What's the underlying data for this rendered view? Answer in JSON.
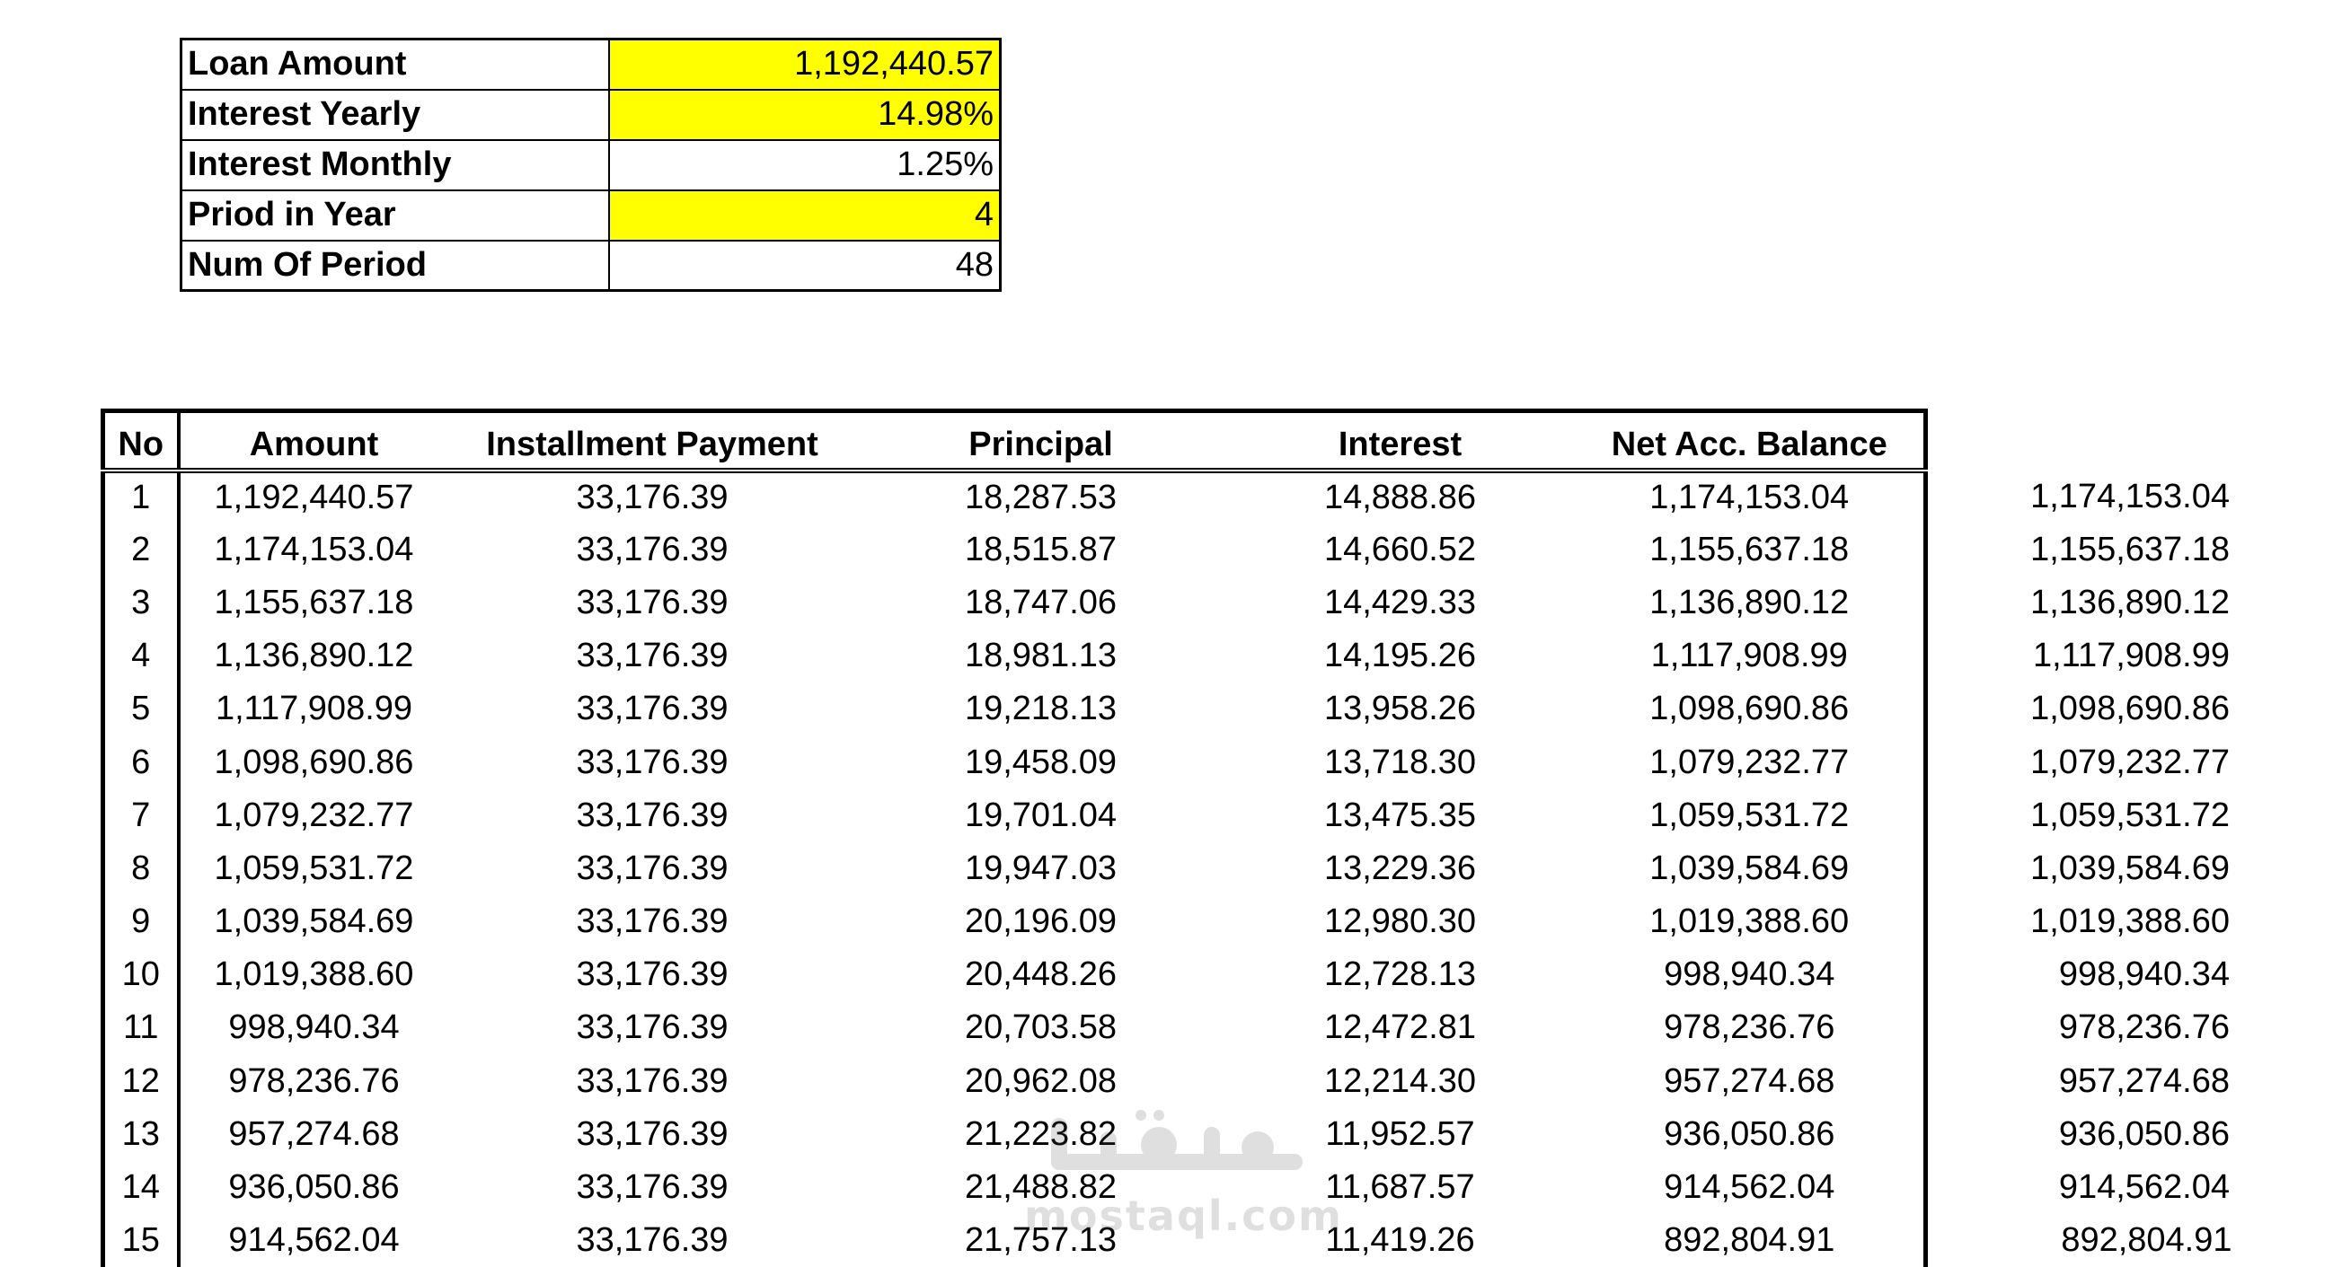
{
  "summary": [
    {
      "label": "Loan Amount",
      "value": "1,192,440.57",
      "highlight": true
    },
    {
      "label": "Interest Yearly",
      "value": "14.98%",
      "highlight": true
    },
    {
      "label": "Interest Monthly",
      "value": "1.25%",
      "highlight": false
    },
    {
      "label": "Priod in Year",
      "value": "4",
      "highlight": true
    },
    {
      "label": "Num Of Period",
      "value": "48",
      "highlight": false
    }
  ],
  "highlight_color": "#ffff00",
  "schedule": {
    "headers": {
      "no": "No",
      "amount": "Amount",
      "installment": "Installment Payment",
      "principal": "Principal",
      "interest": "Interest",
      "net": "Net Acc. Balance"
    },
    "rows": [
      [
        "1",
        "1,192,440.57",
        "33,176.39",
        "18,287.53",
        "14,888.86",
        "1,174,153.04",
        "1,174,153.04"
      ],
      [
        "2",
        "1,174,153.04",
        "33,176.39",
        "18,515.87",
        "14,660.52",
        "1,155,637.18",
        "1,155,637.18"
      ],
      [
        "3",
        "1,155,637.18",
        "33,176.39",
        "18,747.06",
        "14,429.33",
        "1,136,890.12",
        "1,136,890.12"
      ],
      [
        "4",
        "1,136,890.12",
        "33,176.39",
        "18,981.13",
        "14,195.26",
        "1,117,908.99",
        "1,117,908.99"
      ],
      [
        "5",
        "1,117,908.99",
        "33,176.39",
        "19,218.13",
        "13,958.26",
        "1,098,690.86",
        "1,098,690.86"
      ],
      [
        "6",
        "1,098,690.86",
        "33,176.39",
        "19,458.09",
        "13,718.30",
        "1,079,232.77",
        "1,079,232.77"
      ],
      [
        "7",
        "1,079,232.77",
        "33,176.39",
        "19,701.04",
        "13,475.35",
        "1,059,531.72",
        "1,059,531.72"
      ],
      [
        "8",
        "1,059,531.72",
        "33,176.39",
        "19,947.03",
        "13,229.36",
        "1,039,584.69",
        "1,039,584.69"
      ],
      [
        "9",
        "1,039,584.69",
        "33,176.39",
        "20,196.09",
        "12,980.30",
        "1,019,388.60",
        "1,019,388.60"
      ],
      [
        "10",
        "1,019,388.60",
        "33,176.39",
        "20,448.26",
        "12,728.13",
        "998,940.34",
        "998,940.34"
      ],
      [
        "11",
        "998,940.34",
        "33,176.39",
        "20,703.58",
        "12,472.81",
        "978,236.76",
        "978,236.76"
      ],
      [
        "12",
        "978,236.76",
        "33,176.39",
        "20,962.08",
        "12,214.30",
        "957,274.68",
        "957,274.68"
      ],
      [
        "13",
        "957,274.68",
        "33,176.39",
        "21,223.82",
        "11,952.57",
        "936,050.86",
        "936,050.86"
      ],
      [
        "14",
        "936,050.86",
        "33,176.39",
        "21,488.82",
        "11,687.57",
        "914,562.04",
        "914,562.04"
      ],
      [
        "15",
        "914,562.04",
        "33,176.39",
        "21,757.13",
        "11,419.26",
        "892,804.91",
        "892,804.91"
      ]
    ]
  },
  "watermark": {
    "text": "mostaql.com"
  }
}
